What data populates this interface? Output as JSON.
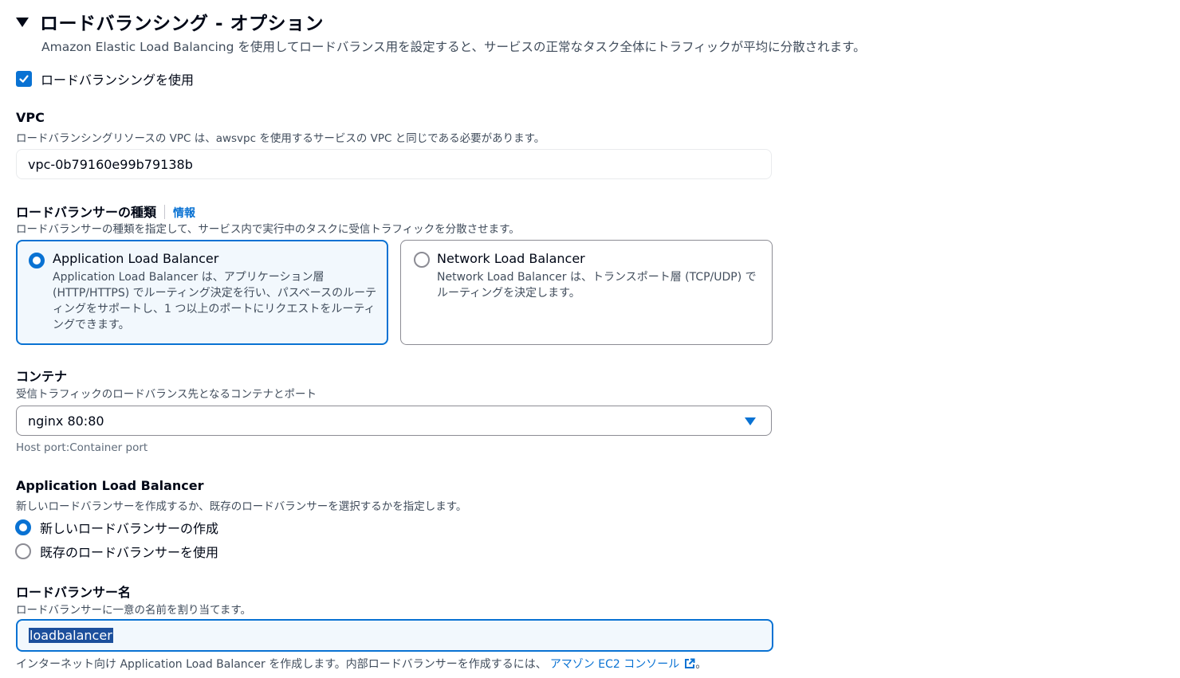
{
  "section": {
    "title": "ロードバランシング - オプション",
    "description": "Amazon Elastic Load Balancing を使用してロードバランス用を設定すると、サービスの正常なタスク全体にトラフィックが平均に分散されます。"
  },
  "use_lb": {
    "label": "ロードバランシングを使用",
    "checked": true
  },
  "vpc": {
    "label": "VPC",
    "description": "ロードバランシングリソースの VPC は、awsvpc を使用するサービスの VPC と同じである必要があります。",
    "value": "vpc-0b79160e99b79138b"
  },
  "lb_type": {
    "label": "ロードバランサーの種類",
    "info": "情報",
    "description": "ロードバランサーの種類を指定して、サービス内で実行中のタスクに受信トラフィックを分散させます。",
    "options": [
      {
        "title": "Application Load Balancer",
        "description": "Application Load Balancer は、アプリケーション層 (HTTP/HTTPS) でルーティング決定を行い、パスベースのルーティングをサポートし、1 つ以上のポートにリクエストをルーティングできます。",
        "selected": true
      },
      {
        "title": "Network Load Balancer",
        "description": "Network Load Balancer は、トランスポート層 (TCP/UDP) でルーティングを決定します。",
        "selected": false
      }
    ]
  },
  "container": {
    "label": "コンテナ",
    "description": "受信トラフィックのロードバランス先となるコンテナとポート",
    "value": "nginx 80:80",
    "hint": "Host port:Container port"
  },
  "alb": {
    "label": "Application Load Balancer",
    "description": "新しいロードバランサーを作成するか、既存のロードバランサーを選択するかを指定します。",
    "options": [
      {
        "label": "新しいロードバランサーの作成",
        "selected": true
      },
      {
        "label": "既存のロードバランサーを使用",
        "selected": false
      }
    ]
  },
  "lb_name": {
    "label": "ロードバランサー名",
    "description": "ロードバランサーに一意の名前を割り当てます。",
    "value": "loadbalancer",
    "note": "インターネット向け Application Load Balancer を作成します。内部ロードバランサーを作成するには、",
    "link": "アマゾン EC2 コンソール",
    "note_end": "。"
  },
  "colors": {
    "accent": "#0972d3",
    "text": "#000716",
    "secondary_text": "#414d5c"
  },
  "icons": {
    "collapse": "caret-down-icon",
    "external": "external-link-icon"
  }
}
